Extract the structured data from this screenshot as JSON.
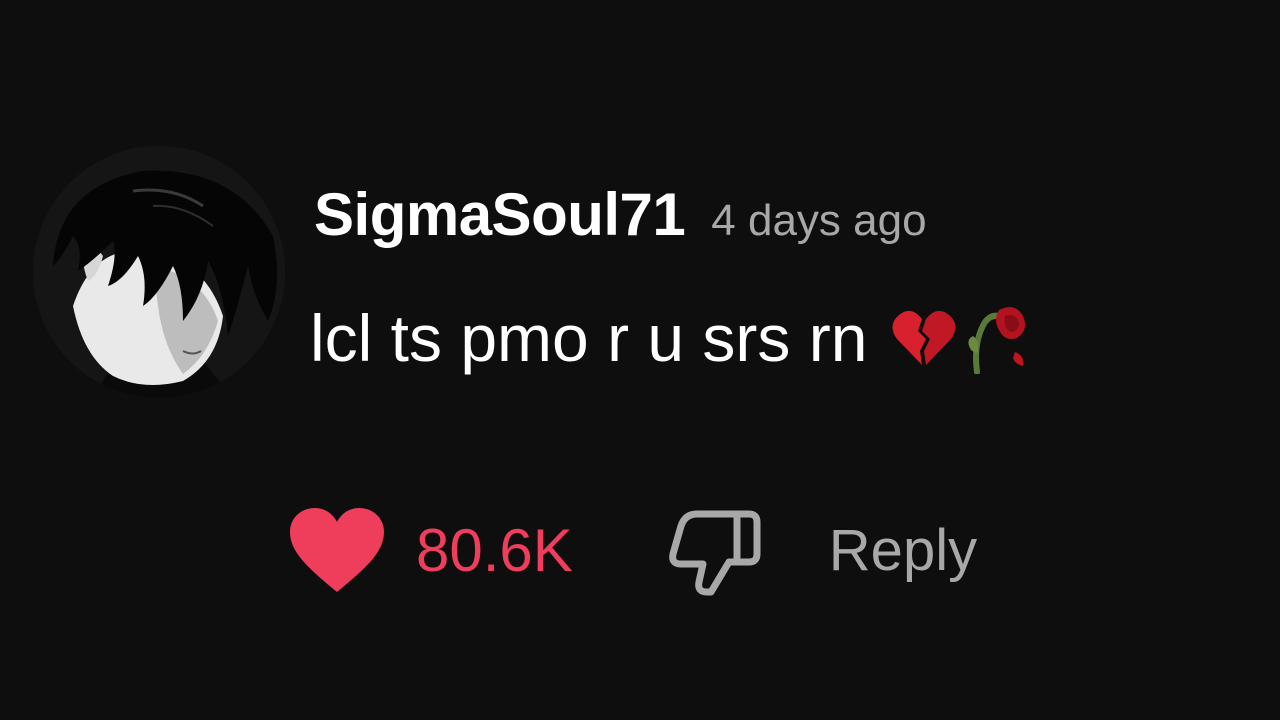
{
  "comment": {
    "username": "SigmaSoul71",
    "timestamp": "4 days ago",
    "text": "lcl ts pmo r u srs rn",
    "emojis": [
      "broken-heart-emoji",
      "wilted-flower-emoji"
    ],
    "avatar_icon": "anime-boy-avatar"
  },
  "actions": {
    "like_icon": "heart-icon",
    "like_count": "80.6K",
    "like_color": "#ee3e5c",
    "dislike_icon": "thumbs-down-icon",
    "reply_label": "Reply"
  },
  "colors": {
    "background": "#0e0e0f",
    "primary_text": "#ffffff",
    "secondary_text": "#a8a8a8",
    "accent": "#ee3e5c"
  }
}
